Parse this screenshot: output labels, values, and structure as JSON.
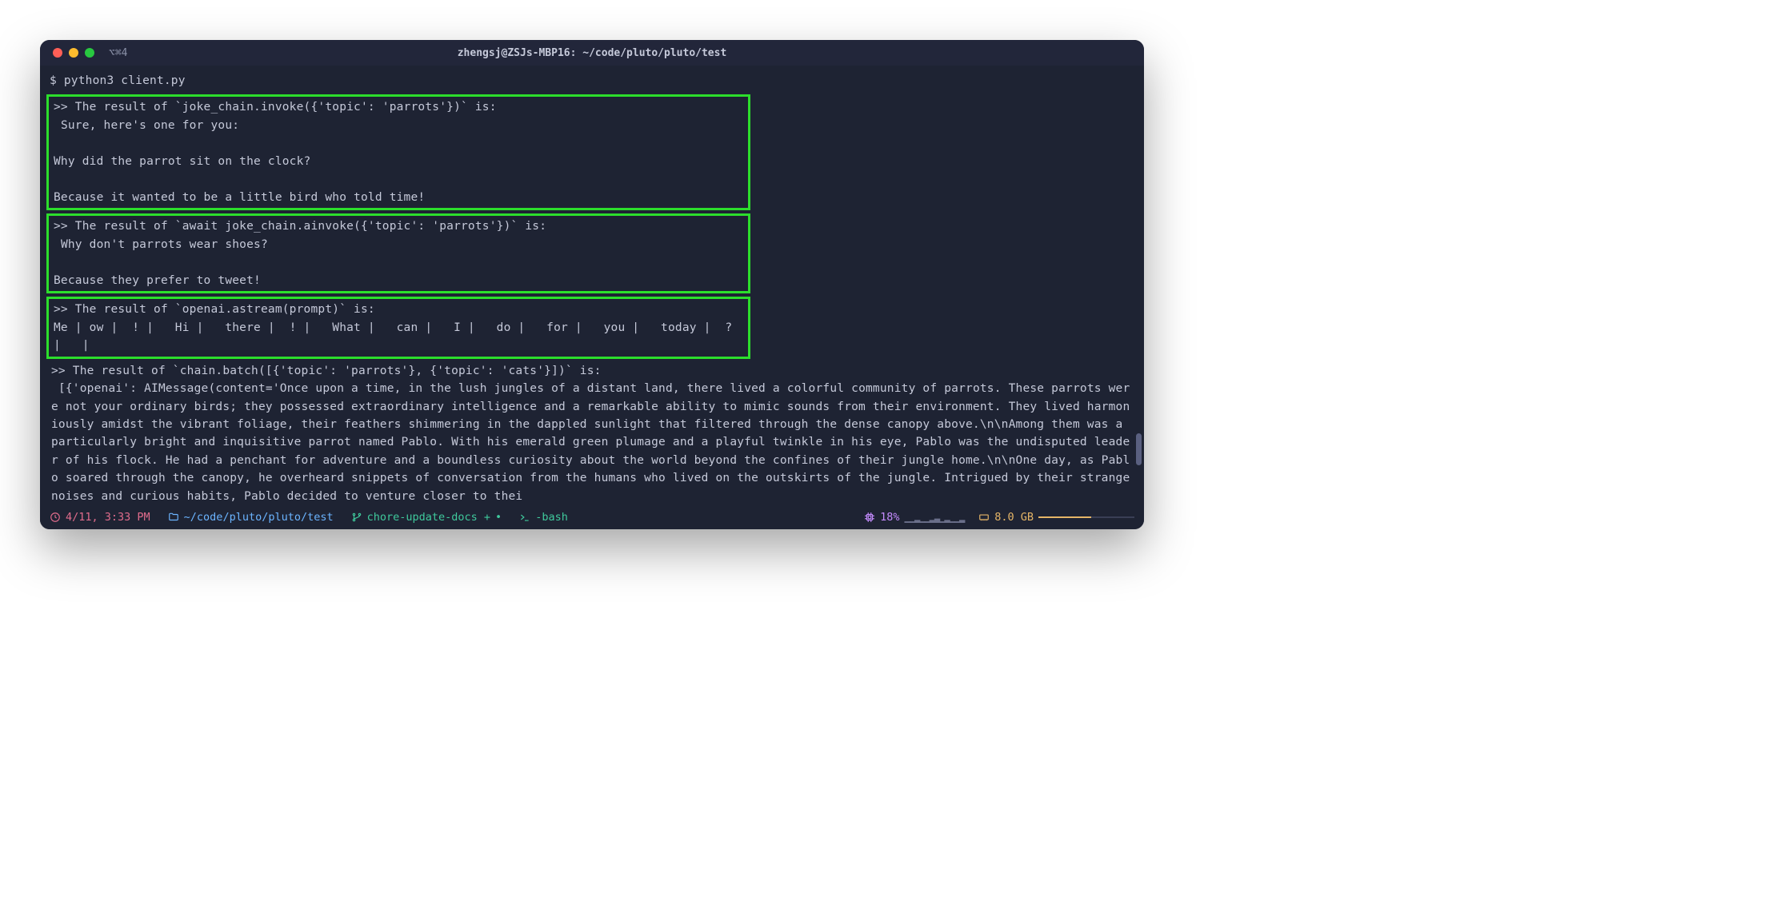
{
  "titlebar": {
    "tab_indicator": "⌥⌘4",
    "title": "zhengsj@ZSJs-MBP16: ~/code/pluto/pluto/test"
  },
  "command_line": "$ python3 client.py",
  "blocks": {
    "b1": ">> The result of `joke_chain.invoke({'topic': 'parrots'})` is:\n Sure, here's one for you:\n\nWhy did the parrot sit on the clock?\n\nBecause it wanted to be a little bird who told time!",
    "b2": ">> The result of `await joke_chain.ainvoke({'topic': 'parrots'})` is:\n Why don't parrots wear shoes?\n\nBecause they prefer to tweet!",
    "b3": ">> The result of `openai.astream(prompt)` is:\nMe | ow |  ! |   Hi |   there |  ! |   What |   can |   I |   do |   for |   you |   today |  ? |   |",
    "b4": ">> The result of `chain.batch([{'topic': 'parrots'}, {'topic': 'cats'}])` is:\n [{'openai': AIMessage(content='Once upon a time, in the lush jungles of a distant land, there lived a colorful community of parrots. These parrots were not your ordinary birds; they possessed extraordinary intelligence and a remarkable ability to mimic sounds from their environment. They lived harmoniously amidst the vibrant foliage, their feathers shimmering in the dappled sunlight that filtered through the dense canopy above.\\n\\nAmong them was a particularly bright and inquisitive parrot named Pablo. With his emerald green plumage and a playful twinkle in his eye, Pablo was the undisputed leader of his flock. He had a penchant for adventure and a boundless curiosity about the world beyond the confines of their jungle home.\\n\\nOne day, as Pablo soared through the canopy, he overheard snippets of conversation from the humans who lived on the outskirts of the jungle. Intrigued by their strange noises and curious habits, Pablo decided to venture closer to thei"
  },
  "statusbar": {
    "time": "4/11, 3:33 PM",
    "path": "~/code/pluto/pluto/test",
    "branch": "chore-update-docs +",
    "branch_dot": "•",
    "shell": "-bash",
    "cpu": "18%",
    "ram": "8.0 GB"
  }
}
